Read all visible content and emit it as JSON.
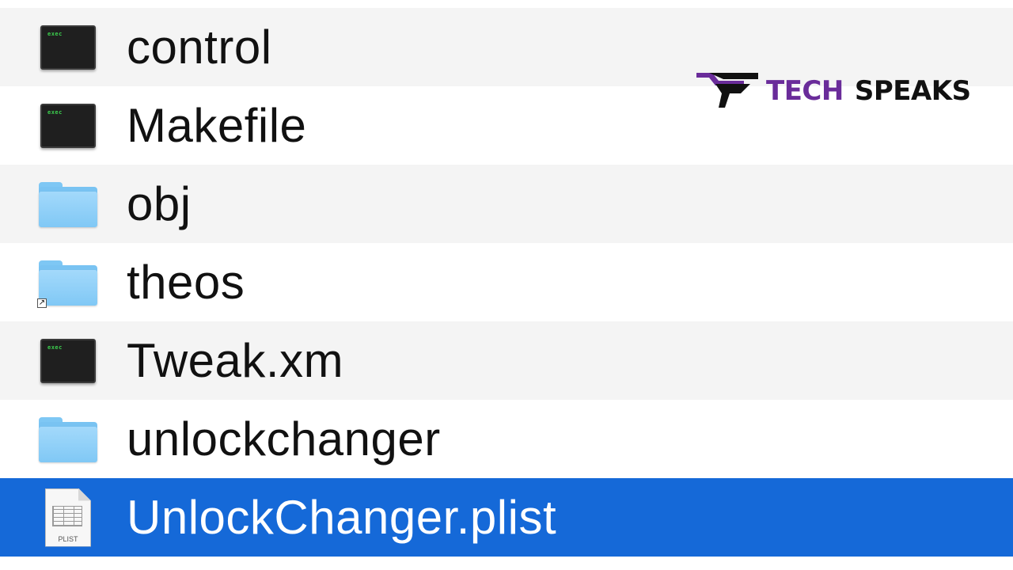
{
  "files": [
    {
      "name": "control",
      "icon": "terminal-exec-icon",
      "exec_label": "exec",
      "row_style": "alt",
      "selected": false
    },
    {
      "name": "Makefile",
      "icon": "terminal-exec-icon",
      "exec_label": "exec",
      "row_style": "plain",
      "selected": false
    },
    {
      "name": "obj",
      "icon": "folder-icon",
      "row_style": "alt",
      "selected": false
    },
    {
      "name": "theos",
      "icon": "folder-alias-icon",
      "row_style": "plain",
      "selected": false
    },
    {
      "name": "Tweak.xm",
      "icon": "terminal-exec-icon",
      "exec_label": "exec",
      "row_style": "alt",
      "selected": false
    },
    {
      "name": "unlockchanger",
      "icon": "folder-icon",
      "row_style": "plain",
      "selected": false
    },
    {
      "name": "UnlockChanger.plist",
      "icon": "plist-document-icon",
      "doc_label": "PLIST",
      "row_style": "selected",
      "selected": true
    }
  ],
  "logo": {
    "word1": "TECH",
    "word2": "SPEAKS"
  },
  "colors": {
    "selection": "#1569d8",
    "alt_row": "#f4f4f4",
    "folder": "#80c8f5",
    "logo_accent": "#6a2c9a"
  }
}
